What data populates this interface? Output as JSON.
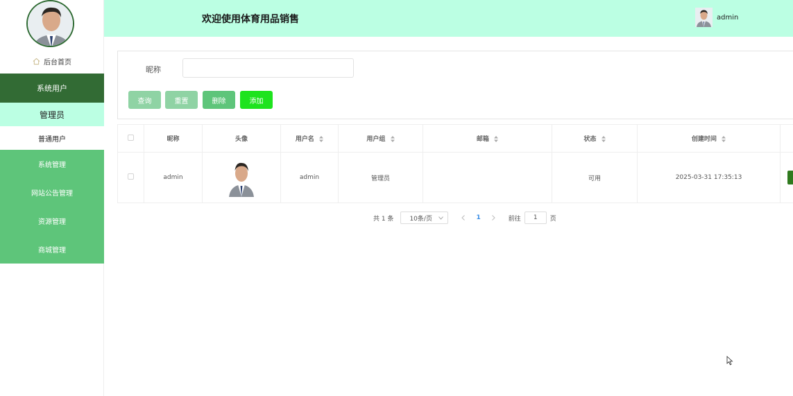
{
  "sidebar": {
    "home_label": "后台首页",
    "menu": [
      {
        "label": "系统用户"
      },
      {
        "label": "管理员"
      },
      {
        "label": "普通用户"
      },
      {
        "label": "系统管理"
      },
      {
        "label": "网站公告管理"
      },
      {
        "label": "资源管理"
      },
      {
        "label": "商城管理"
      }
    ]
  },
  "header": {
    "title": "欢迎使用体育用品销售",
    "username": "admin"
  },
  "search": {
    "label": "昵称",
    "value": "",
    "buttons": {
      "query": "查询",
      "reset": "重置",
      "delete": "删除",
      "add": "添加"
    }
  },
  "table": {
    "columns": [
      "昵称",
      "头像",
      "用户名",
      "用户组",
      "邮箱",
      "状态",
      "创建时间"
    ],
    "rows": [
      {
        "nickname": "admin",
        "username": "admin",
        "group": "管理员",
        "email": "",
        "status": "可用",
        "created": "2025-03-31 17:35:13"
      }
    ]
  },
  "pagination": {
    "total": "共 1 条",
    "page_size": "10条/页",
    "current": "1",
    "goto_prefix": "前往",
    "goto_value": "1",
    "goto_suffix": "页"
  },
  "colors": {
    "header_bg": "#bbffe3",
    "menu_group": "#326b34",
    "menu_green": "#5ec57a",
    "add_button": "#1ee31e"
  }
}
